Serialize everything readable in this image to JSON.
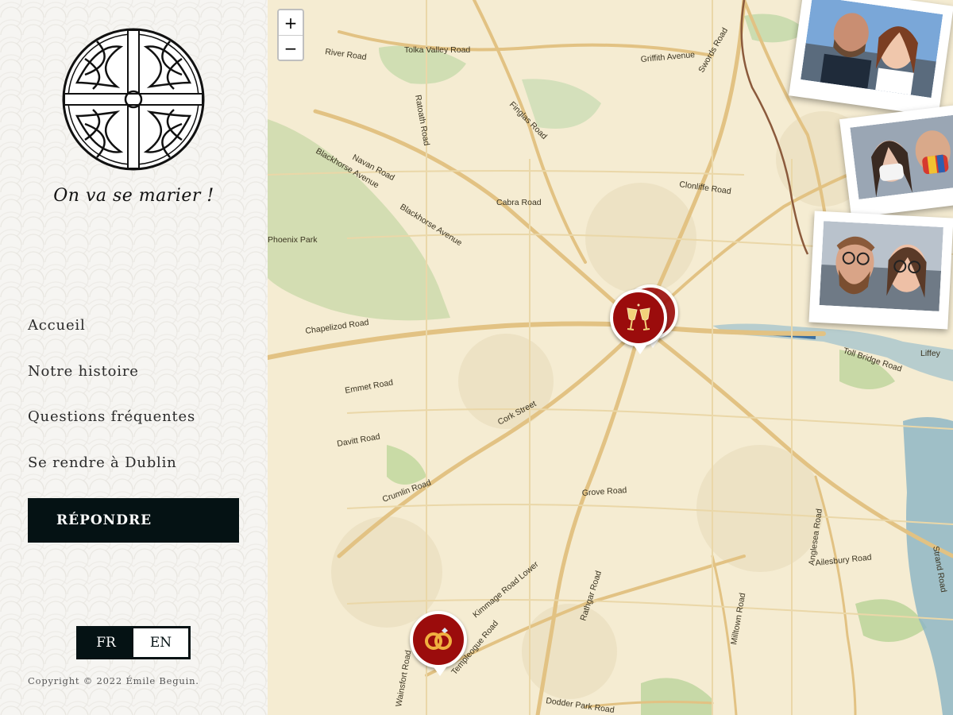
{
  "sidebar": {
    "tagline": "On va se marier !",
    "nav": [
      {
        "label": "Accueil"
      },
      {
        "label": "Notre histoire"
      },
      {
        "label": "Questions fréquentes"
      },
      {
        "label": "Se rendre à Dublin"
      }
    ],
    "cta_label": "RÉPONDRE",
    "languages": [
      "FR",
      "EN"
    ],
    "selected_language": "FR",
    "copyright": "Copyright © 2022 Émile Beguin."
  },
  "map": {
    "zoom_in": "+",
    "zoom_out": "−",
    "streets": [
      "River Road",
      "Tolka Valley Road",
      "Griffith Avenue",
      "Swords Road",
      "Ratoath Road",
      "Finglas Road",
      "Navan Road",
      "Blackhorse Avenue",
      "Cabra Road",
      "Clonliffe Road",
      "Blackhorse Avenue",
      "Phoenix Park",
      "Chapelizod Road",
      "Toll Bridge Road",
      "Liffey",
      "Emmet Road",
      "Cork Street",
      "Davitt Road",
      "Crumlin Road",
      "Grove Road",
      "Kimmage Road Lower",
      "Rathgar Road",
      "Milltown Road",
      "Anglesea Road",
      "Ailesbury Road",
      "Strand Road",
      "Wainsfort Road",
      "Templeogue Road",
      "Dodder Park Road"
    ],
    "markers": [
      {
        "name": "reception-marker",
        "icon": "champagne-glasses-icon"
      },
      {
        "name": "ceremony-marker",
        "icon": "wedding-rings-icon"
      }
    ],
    "colors": {
      "marker": "#9b0c0c",
      "button": "#051214"
    }
  }
}
